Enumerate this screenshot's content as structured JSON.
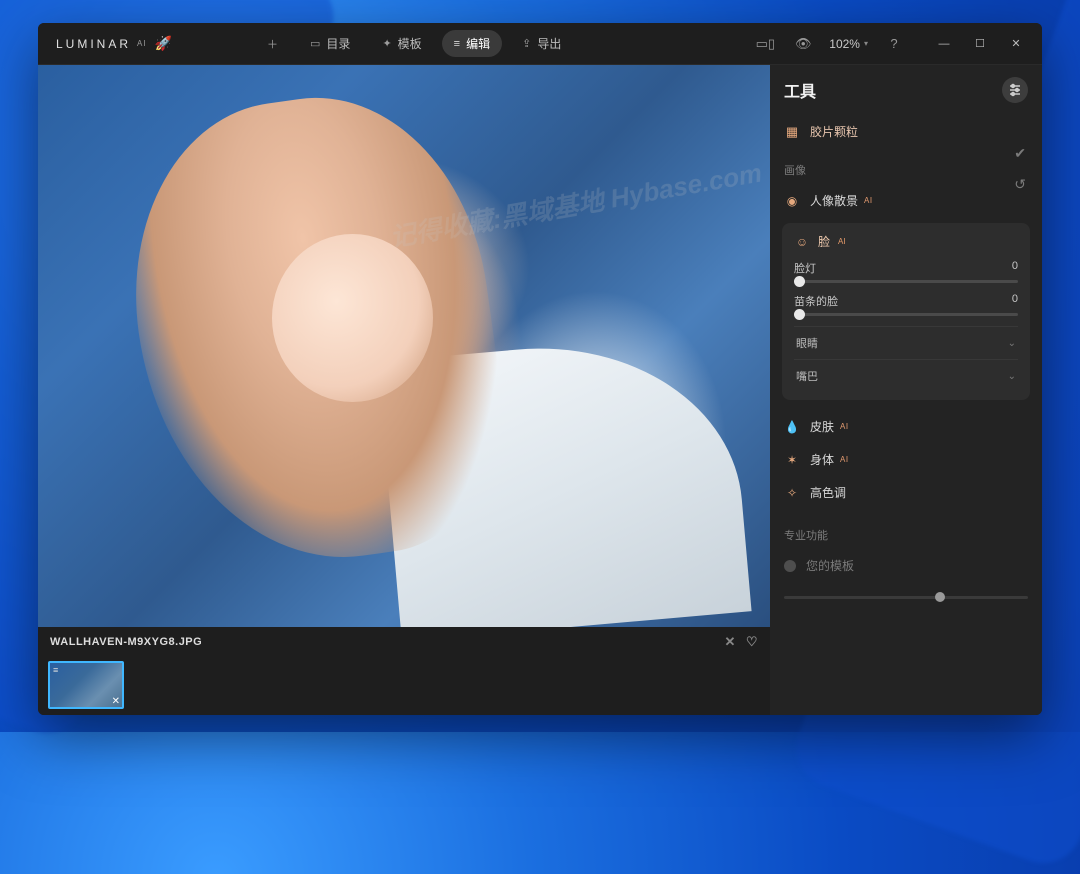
{
  "brand": {
    "name": "LUMINAR",
    "suffix": "AI"
  },
  "titlebar": {
    "add": "+",
    "tabs": {
      "catalog": "目录",
      "templates": "模板",
      "edit": "编辑",
      "export": "导出"
    },
    "zoom": "102%"
  },
  "file": {
    "name": "WALLHAVEN-M9XYG8.JPG"
  },
  "panel": {
    "title": "工具",
    "film_grain": "胶片颗粒",
    "section_image": "画像",
    "bokeh": "人像散景",
    "face_card": {
      "title": "脸",
      "sliders": {
        "facelight_label": "脸灯",
        "facelight_value": "0",
        "slim_label": "苗条的脸",
        "slim_value": "0"
      },
      "eyes": "眼睛",
      "mouth": "嘴巴"
    },
    "skin": "皮肤",
    "body": "身体",
    "high_key": "高色调",
    "section_pro": "专业功能",
    "your_template": "您的模板"
  },
  "watermark": "记得收藏:黑域基地 Hybase.com"
}
